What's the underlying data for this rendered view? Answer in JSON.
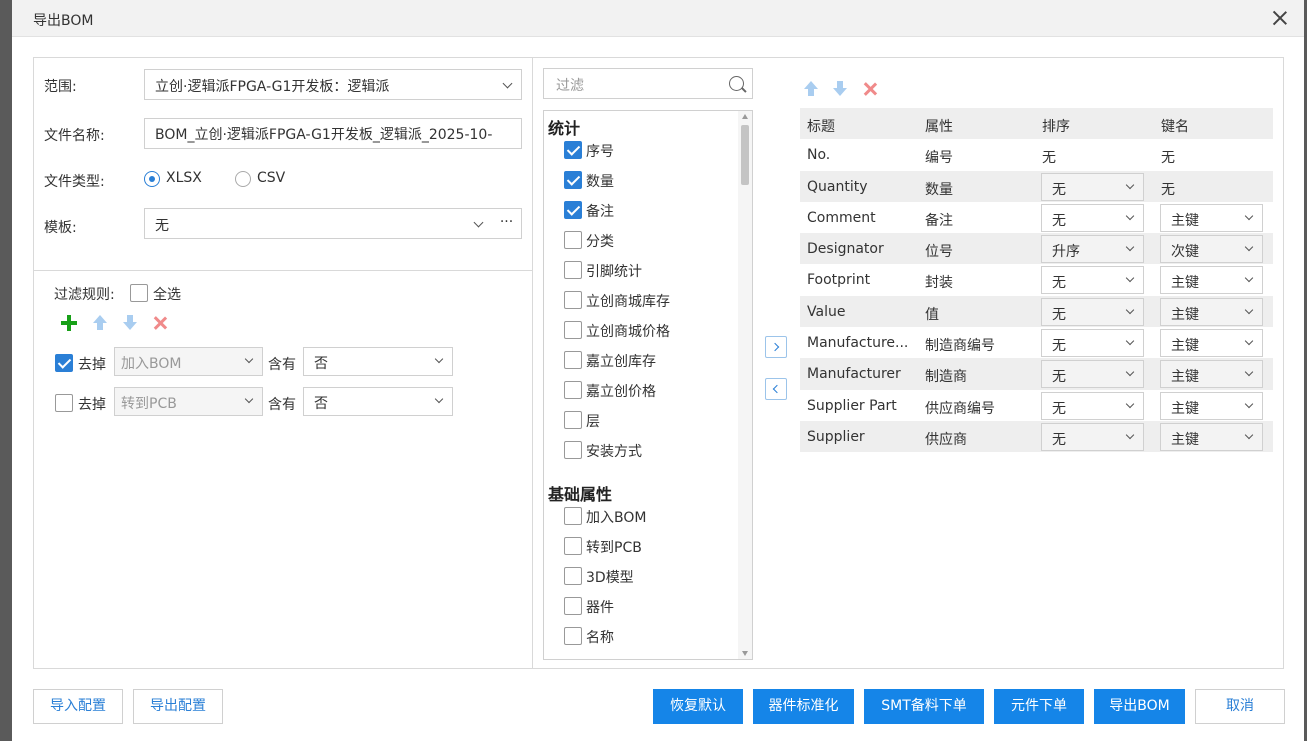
{
  "dialog": {
    "title": "导出BOM"
  },
  "form": {
    "range_label": "范围:",
    "range_value": "立创·逻辑派FPGA-G1开发板：逻辑派",
    "filename_label": "文件名称:",
    "filename_value": "BOM_立创·逻辑派FPGA-G1开发板_逻辑派_2025-10-",
    "filetype_label": "文件类型:",
    "filetype_options": [
      "XLSX",
      "CSV"
    ],
    "filetype_selected": "XLSX",
    "template_label": "模板:",
    "template_value": "无",
    "template_more": "···"
  },
  "rules": {
    "label": "过滤规则:",
    "select_all": "全选",
    "items": [
      {
        "checked": true,
        "remove_label": "去掉",
        "field": "加入BOM",
        "contains_label": "含有",
        "value": "否"
      },
      {
        "checked": false,
        "remove_label": "去掉",
        "field": "转到PCB",
        "contains_label": "含有",
        "value": "否"
      }
    ]
  },
  "fields_list": {
    "filter_placeholder": "过滤",
    "groups": [
      {
        "title": "统计",
        "items": [
          {
            "label": "序号",
            "checked": true
          },
          {
            "label": "数量",
            "checked": true
          },
          {
            "label": "备注",
            "checked": true
          },
          {
            "label": "分类",
            "checked": false
          },
          {
            "label": "引脚统计",
            "checked": false
          },
          {
            "label": "立创商城库存",
            "checked": false
          },
          {
            "label": "立创商城价格",
            "checked": false
          },
          {
            "label": "嘉立创库存",
            "checked": false
          },
          {
            "label": "嘉立创价格",
            "checked": false
          },
          {
            "label": "层",
            "checked": false
          },
          {
            "label": "安装方式",
            "checked": false
          }
        ]
      },
      {
        "title": "基础属性",
        "items": [
          {
            "label": "加入BOM",
            "checked": false
          },
          {
            "label": "转到PCB",
            "checked": false
          },
          {
            "label": "3D模型",
            "checked": false
          },
          {
            "label": "器件",
            "checked": false
          },
          {
            "label": "名称",
            "checked": false
          }
        ]
      }
    ]
  },
  "table": {
    "headers": [
      "标题",
      "属性",
      "排序",
      "键名"
    ],
    "rows": [
      {
        "title": "No.",
        "attr": "编号",
        "sort": "无",
        "key": "无",
        "sort_select": false,
        "key_select": false
      },
      {
        "title": "Quantity",
        "attr": "数量",
        "sort": "无",
        "key": "无",
        "sort_select": true,
        "key_select": false
      },
      {
        "title": "Comment",
        "attr": "备注",
        "sort": "无",
        "key": "主键",
        "sort_select": true,
        "key_select": true
      },
      {
        "title": "Designator",
        "attr": "位号",
        "sort": "升序",
        "key": "次键",
        "sort_select": true,
        "key_select": true
      },
      {
        "title": "Footprint",
        "attr": "封装",
        "sort": "无",
        "key": "主键",
        "sort_select": true,
        "key_select": true
      },
      {
        "title": "Value",
        "attr": "值",
        "sort": "无",
        "key": "主键",
        "sort_select": true,
        "key_select": true
      },
      {
        "title": "Manufacture...",
        "attr": "制造商编号",
        "sort": "无",
        "key": "主键",
        "sort_select": true,
        "key_select": true
      },
      {
        "title": "Manufacturer",
        "attr": "制造商",
        "sort": "无",
        "key": "主键",
        "sort_select": true,
        "key_select": true
      },
      {
        "title": "Supplier Part",
        "attr": "供应商编号",
        "sort": "无",
        "key": "主键",
        "sort_select": true,
        "key_select": true
      },
      {
        "title": "Supplier",
        "attr": "供应商",
        "sort": "无",
        "key": "主键",
        "sort_select": true,
        "key_select": true
      }
    ]
  },
  "footer": {
    "import_config": "导入配置",
    "export_config": "导出配置",
    "restore_default": "恢复默认",
    "standardize": "器件标准化",
    "smt_order": "SMT备料下单",
    "parts_order": "元件下单",
    "export_bom": "导出BOM",
    "cancel": "取消"
  },
  "colors": {
    "primary": "#1585e8",
    "checkbox": "#2a7fd6",
    "add_icon": "#18a018",
    "delete_icon": "#f08a8a"
  }
}
